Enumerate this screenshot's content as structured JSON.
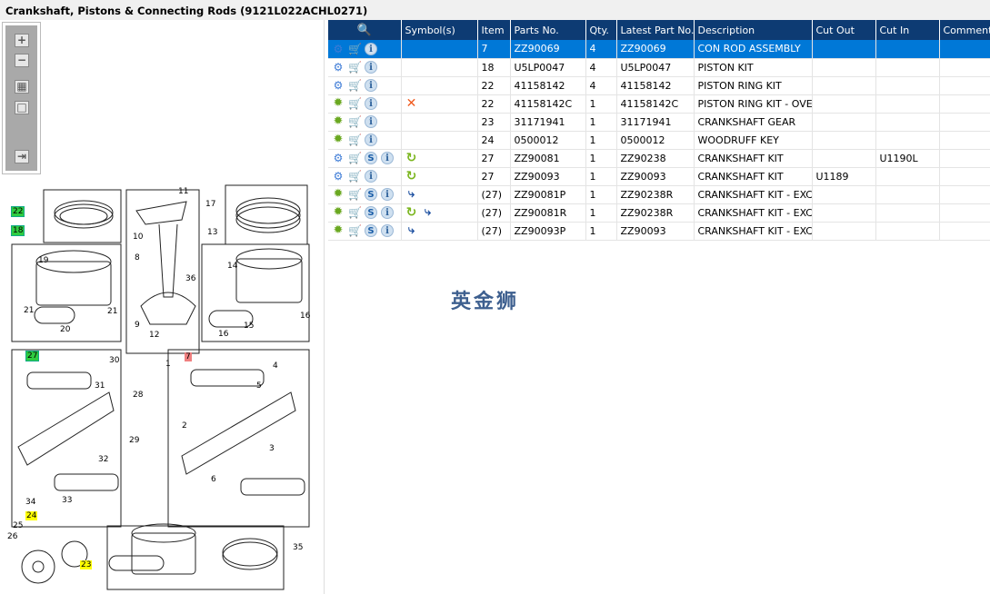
{
  "title": "Crankshaft, Pistons & Connecting Rods (9121L022ACHL0271)",
  "watermark": "英金狮",
  "toolbar": {
    "zoom_in": "+",
    "zoom_out": "−",
    "fit": "▦",
    "actual": "□",
    "export": "⇥"
  },
  "diagram": {
    "callouts": [
      "22",
      "18",
      "19",
      "21",
      "20",
      "21",
      "11",
      "10",
      "8",
      "36",
      "9",
      "12",
      "7",
      "17",
      "13",
      "14",
      "16",
      "15",
      "16",
      "27",
      "30",
      "31",
      "28",
      "29",
      "32",
      "34",
      "33",
      "1",
      "4",
      "5",
      "2",
      "3",
      "6",
      "24",
      "25",
      "26",
      "23",
      "35"
    ]
  },
  "table": {
    "headers": [
      "",
      "Symbol(s)",
      "Item",
      "Parts No.",
      "Qty.",
      "Latest Part No.",
      "Description",
      "Cut Out",
      "Cut In",
      "Comment"
    ],
    "rows": [
      {
        "icons": "gears",
        "s": false,
        "symbols": [],
        "item": "7",
        "part": "ZZ90069",
        "qty": "4",
        "latest": "ZZ90069",
        "desc": "CON ROD ASSEMBLY",
        "cut_out": "",
        "cut_in": "",
        "comment": "",
        "selected": true
      },
      {
        "icons": "gears",
        "s": false,
        "symbols": [],
        "item": "18",
        "part": "U5LP0047",
        "qty": "4",
        "latest": "U5LP0047",
        "desc": "PISTON KIT",
        "cut_out": "",
        "cut_in": "",
        "comment": ""
      },
      {
        "icons": "gears",
        "s": false,
        "symbols": [],
        "item": "22",
        "part": "41158142",
        "qty": "4",
        "latest": "41158142",
        "desc": "PISTON RING KIT",
        "cut_out": "",
        "cut_in": "",
        "comment": ""
      },
      {
        "icons": "gear",
        "s": false,
        "symbols": [
          "cross"
        ],
        "item": "22",
        "part": "41158142C",
        "qty": "1",
        "latest": "41158142C",
        "desc": "PISTON RING KIT - OVERSIZE",
        "cut_out": "",
        "cut_in": "",
        "comment": ""
      },
      {
        "icons": "gear",
        "s": false,
        "symbols": [],
        "item": "23",
        "part": "31171941",
        "qty": "1",
        "latest": "31171941",
        "desc": "CRANKSHAFT GEAR",
        "cut_out": "",
        "cut_in": "",
        "comment": ""
      },
      {
        "icons": "gear",
        "s": false,
        "symbols": [],
        "item": "24",
        "part": "0500012",
        "qty": "1",
        "latest": "0500012",
        "desc": "WOODRUFF KEY",
        "cut_out": "",
        "cut_in": "",
        "comment": ""
      },
      {
        "icons": "gears",
        "s": true,
        "symbols": [
          "cycle"
        ],
        "item": "27",
        "part": "ZZ90081",
        "qty": "1",
        "latest": "ZZ90238",
        "desc": "CRANKSHAFT KIT",
        "cut_out": "",
        "cut_in": "U1190L",
        "comment": ""
      },
      {
        "icons": "gears",
        "s": false,
        "symbols": [
          "cycle"
        ],
        "item": "27",
        "part": "ZZ90093",
        "qty": "1",
        "latest": "ZZ90093",
        "desc": "CRANKSHAFT KIT",
        "cut_out": "U1189",
        "cut_in": "",
        "comment": ""
      },
      {
        "icons": "gear",
        "s": true,
        "symbols": [
          "branch"
        ],
        "item": "(27)",
        "part": "ZZ90081P",
        "qty": "1",
        "latest": "ZZ90238R",
        "desc": "CRANKSHAFT KIT - EXCHANGE",
        "cut_out": "",
        "cut_in": "",
        "comment": ""
      },
      {
        "icons": "gear",
        "s": true,
        "symbols": [
          "cycle",
          "branch"
        ],
        "item": "(27)",
        "part": "ZZ90081R",
        "qty": "1",
        "latest": "ZZ90238R",
        "desc": "CRANKSHAFT KIT - EXCHANGE",
        "cut_out": "",
        "cut_in": "",
        "comment": ""
      },
      {
        "icons": "gear",
        "s": true,
        "symbols": [
          "branch"
        ],
        "item": "(27)",
        "part": "ZZ90093P",
        "qty": "1",
        "latest": "ZZ90093",
        "desc": "CRANKSHAFT KIT - EXCHANGE",
        "cut_out": "",
        "cut_in": "",
        "comment": ""
      }
    ]
  },
  "colors": {
    "header": "#0d3b73",
    "selected": "#0078d7"
  }
}
